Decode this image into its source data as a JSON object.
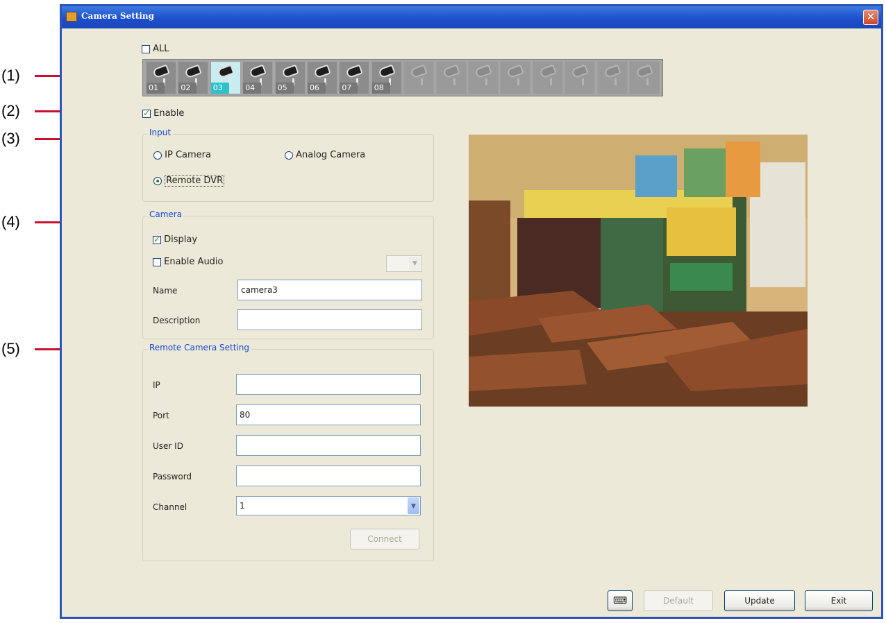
{
  "callouts": [
    "(1)",
    "(2)",
    "(3)",
    "(4)",
    "(5)"
  ],
  "window": {
    "title": "Camera Setting",
    "close_glyph": "✕"
  },
  "all_checkbox": {
    "label": "ALL",
    "checked": false
  },
  "cameras": [
    {
      "id": "01",
      "state": "active"
    },
    {
      "id": "02",
      "state": "active"
    },
    {
      "id": "03",
      "state": "selected"
    },
    {
      "id": "04",
      "state": "active"
    },
    {
      "id": "05",
      "state": "active"
    },
    {
      "id": "06",
      "state": "active"
    },
    {
      "id": "07",
      "state": "active"
    },
    {
      "id": "08",
      "state": "active"
    },
    {
      "id": "",
      "state": "disabled"
    },
    {
      "id": "",
      "state": "disabled"
    },
    {
      "id": "",
      "state": "disabled"
    },
    {
      "id": "",
      "state": "disabled"
    },
    {
      "id": "",
      "state": "disabled"
    },
    {
      "id": "",
      "state": "disabled"
    },
    {
      "id": "",
      "state": "disabled"
    },
    {
      "id": "",
      "state": "disabled"
    }
  ],
  "enable": {
    "label": "Enable",
    "checked": true
  },
  "input": {
    "title": "Input",
    "ip_camera": "IP Camera",
    "analog_camera": "Analog Camera",
    "remote_dvr": "Remote DVR",
    "selected": "remote_dvr"
  },
  "camera": {
    "title": "Camera",
    "display_label": "Display",
    "display_checked": true,
    "audio_label": "Enable Audio",
    "audio_checked": false,
    "name_label": "Name",
    "name_value": "camera3",
    "description_label": "Description",
    "description_value": ""
  },
  "remote": {
    "title": "Remote Camera Setting",
    "ip_label": "IP",
    "ip_value": "",
    "port_label": "Port",
    "port_value": "80",
    "userid_label": "User ID",
    "userid_value": "",
    "password_label": "Password",
    "password_value": "",
    "channel_label": "Channel",
    "channel_value": "1",
    "connect_label": "Connect"
  },
  "buttons": {
    "default": "Default",
    "update": "Update",
    "exit": "Exit"
  },
  "colors": {
    "titlebar": "#1d4fcc",
    "window_bg": "#ece9d8",
    "group_title": "#1548d6",
    "callout_line": "#c8102e",
    "selected_camera": "#2ec1c9"
  }
}
